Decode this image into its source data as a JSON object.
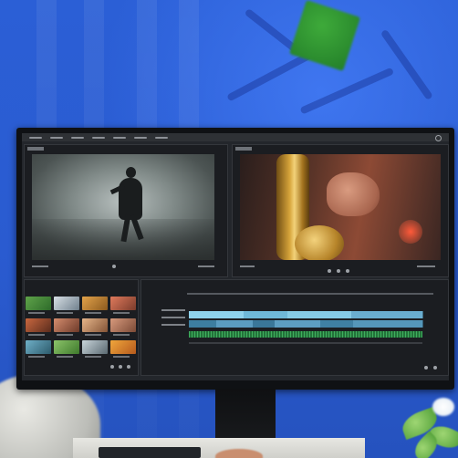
{
  "scene": {
    "colors": {
      "wall": "#2b5fd6",
      "monitor_bezel": "#0f1114",
      "editor_bg": "#23262b",
      "panel_bg": "#1b1d21",
      "timeline_video_track": "#6fb8d8",
      "timeline_audio_track": "#3fae5e",
      "accent_green": "#2f9a35"
    },
    "icons": [
      "close-icon",
      "play-icon"
    ],
    "elements": {
      "monitor": "video-editing-monitor",
      "left_preview": "dancer-in-corridor",
      "right_preview": "saxophone-closeup",
      "media_bin": "thumbnail-grid",
      "timeline": "multi-track-timeline"
    }
  }
}
